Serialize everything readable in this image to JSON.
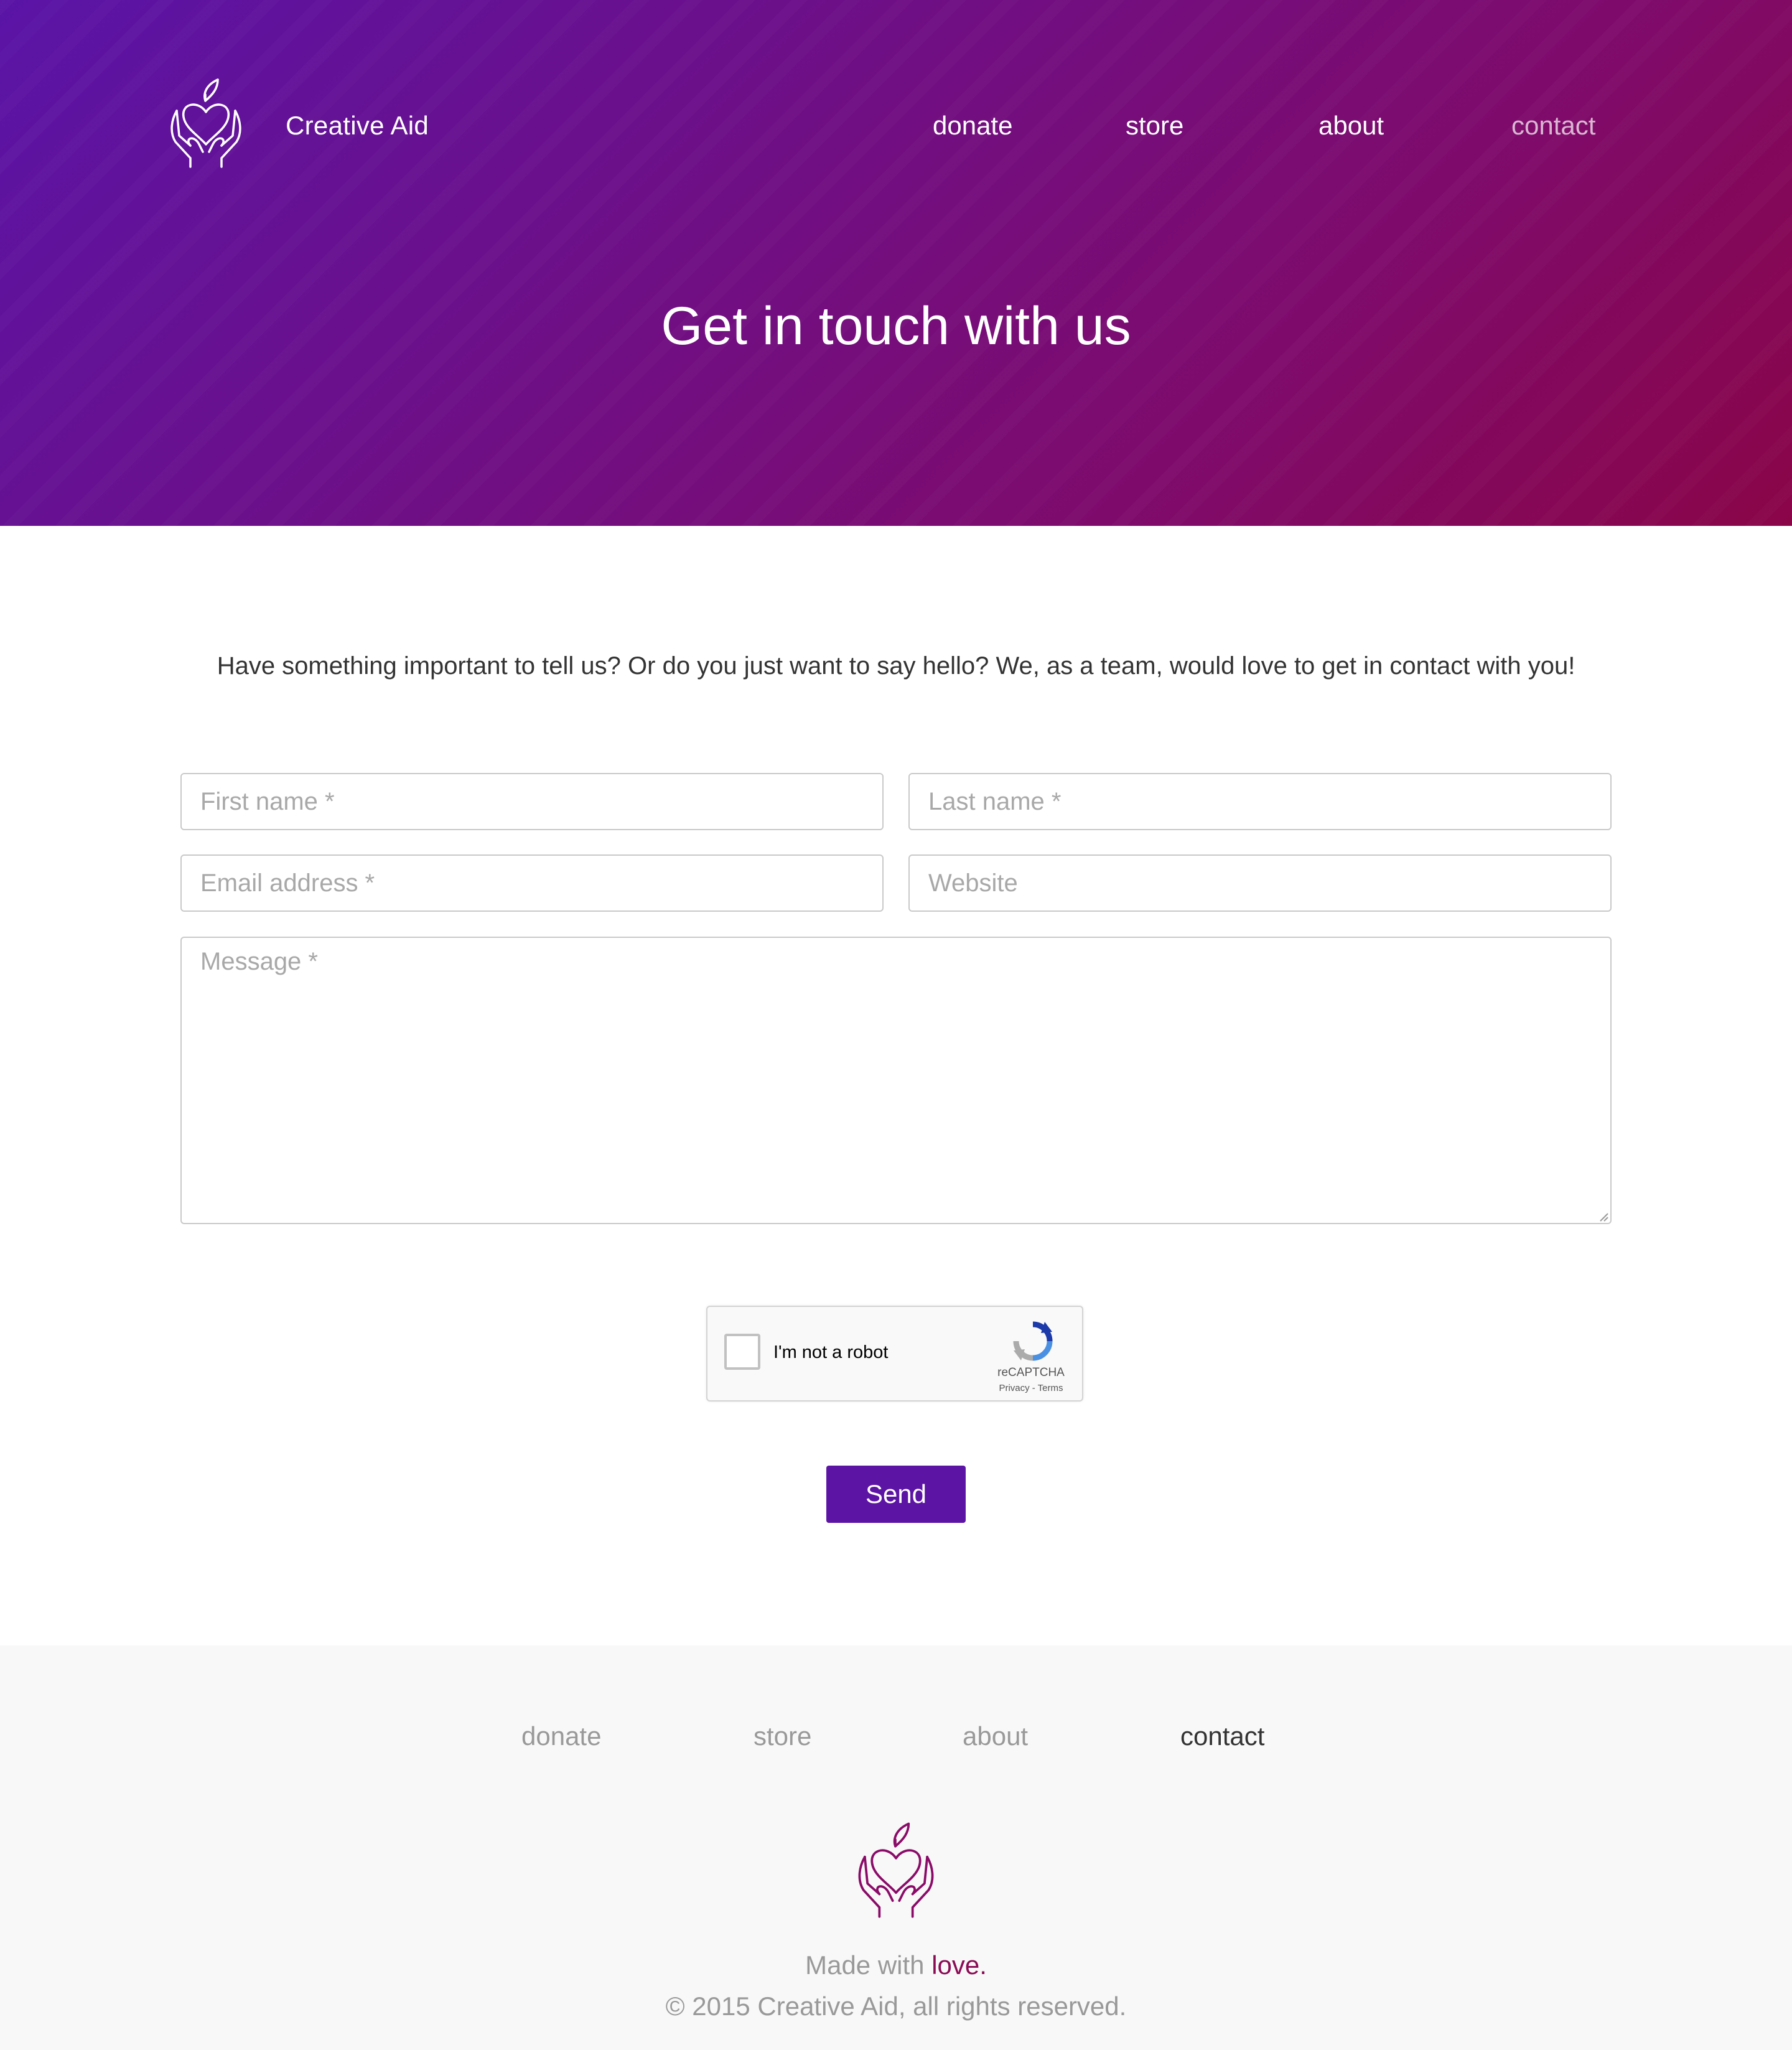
{
  "header": {
    "brand": "Creative Aid",
    "nav": [
      {
        "label": "donate"
      },
      {
        "label": "store"
      },
      {
        "label": "about"
      },
      {
        "label": "contact"
      }
    ],
    "active_nav": "contact",
    "title": "Get in touch with us"
  },
  "intro": {
    "text": "Have something important to tell us? Or do you just want to say hello? We, as a team, would love to get in contact with you!"
  },
  "form": {
    "first_name": {
      "placeholder": "First name *",
      "value": ""
    },
    "last_name": {
      "placeholder": "Last name *",
      "value": ""
    },
    "email": {
      "placeholder": "Email address *",
      "value": ""
    },
    "website": {
      "placeholder": "Website",
      "value": ""
    },
    "message": {
      "placeholder": "Message *",
      "value": ""
    },
    "captcha": {
      "label": "I'm not a robot",
      "brand": "reCAPTCHA",
      "terms": "Privacy - Terms",
      "checked": false
    },
    "send_label": "Send"
  },
  "footer": {
    "nav": [
      {
        "label": "donate"
      },
      {
        "label": "store"
      },
      {
        "label": "about"
      },
      {
        "label": "contact"
      }
    ],
    "active_nav": "contact",
    "made_prefix": "Made with ",
    "made_love": "love.",
    "copyright": "© 2015 Creative Aid, all rights reserved."
  },
  "icons": {
    "logo": "heart-in-hands-icon",
    "captcha_logo": "recaptcha-icon"
  },
  "colors": {
    "hero_gradient_start": "#5a14a6",
    "hero_gradient_end": "#8a0548",
    "button": "#5c14a4",
    "love": "#8a0b55",
    "footer_bg": "#f8f8f8",
    "footer_logo": "#8a0b68"
  }
}
